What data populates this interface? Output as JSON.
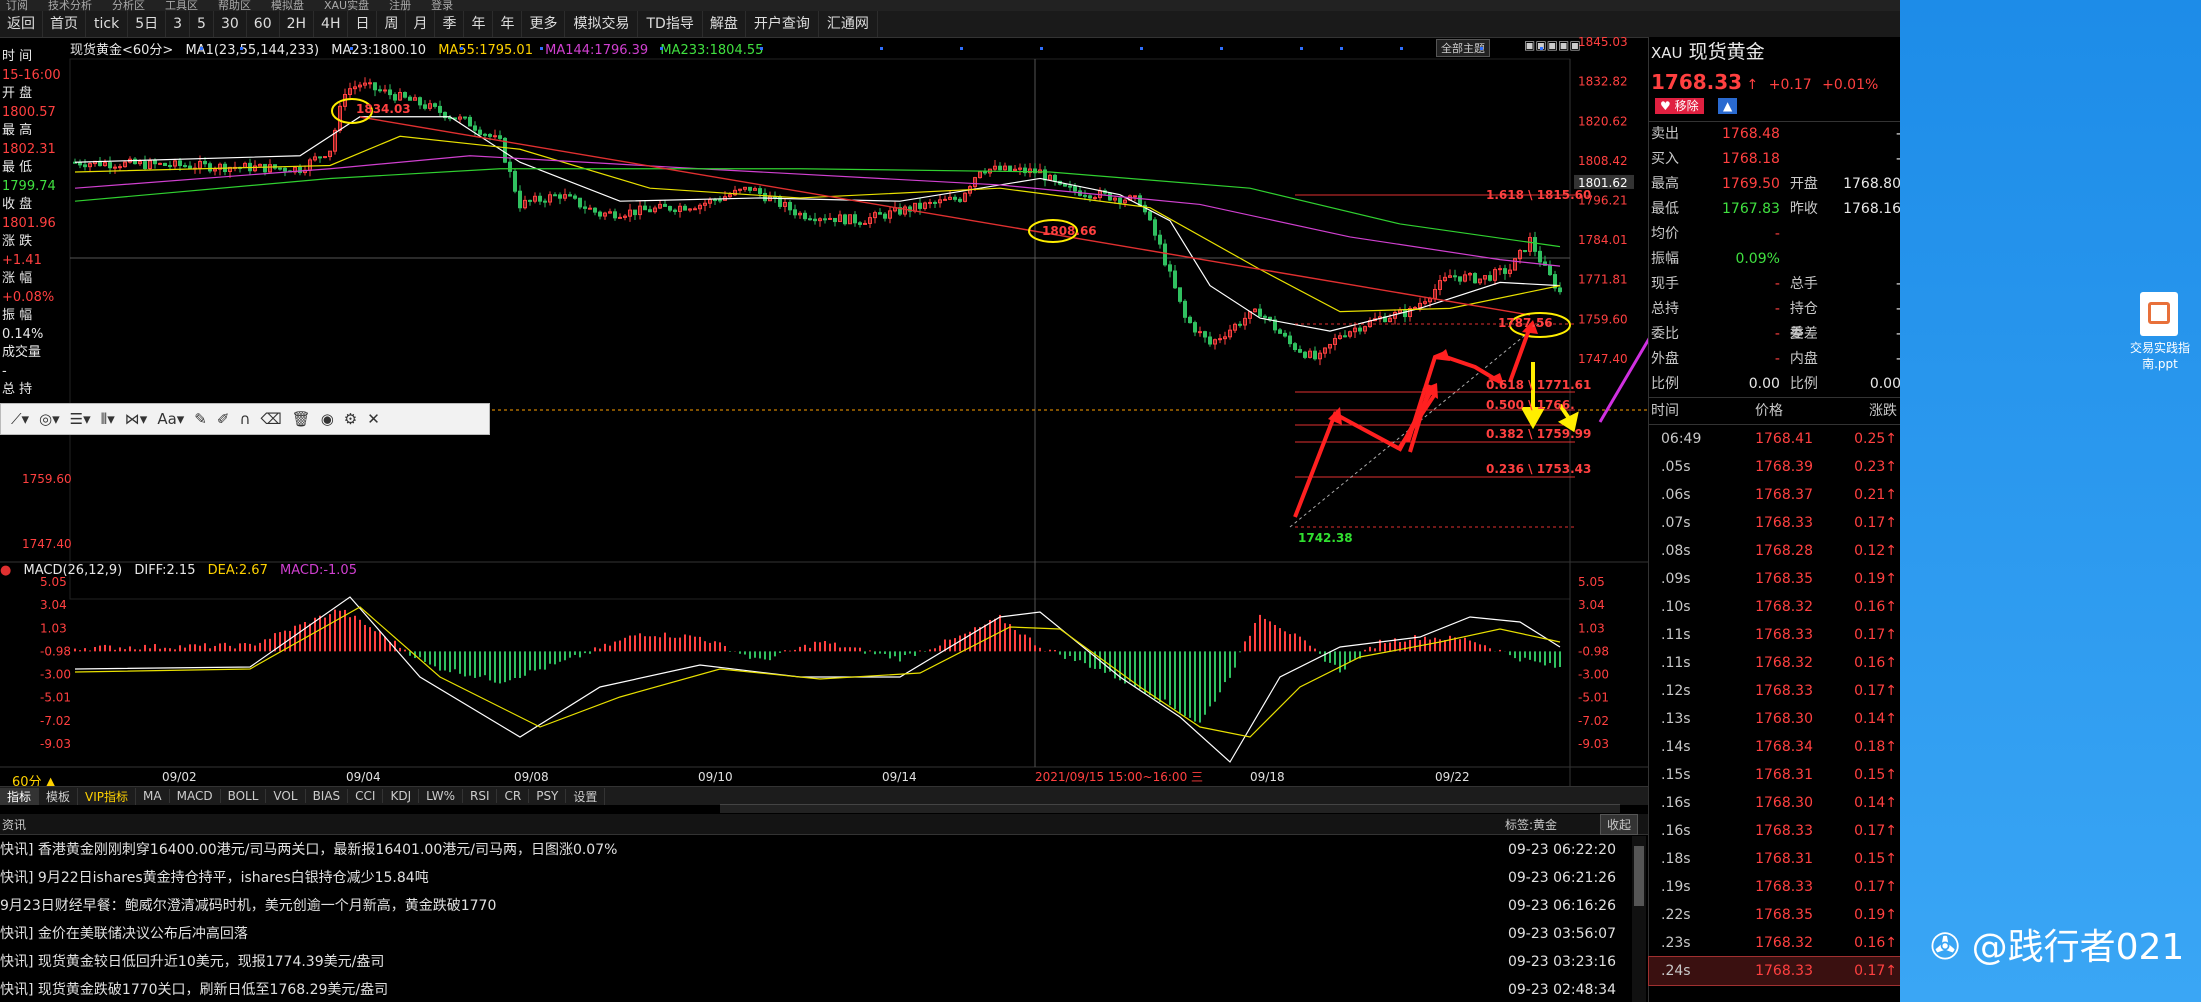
{
  "topstrip": [
    "订阅",
    "技术分析",
    "分析区",
    "工具区",
    "帮助区",
    "模拟盘",
    "XAU实盘",
    "注册",
    "登录"
  ],
  "toolbar": [
    "返回",
    "首页",
    "tick",
    "5日",
    "3",
    "5",
    "30",
    "60",
    "2H",
    "4H",
    "日",
    "周",
    "月",
    "季",
    "年",
    "年",
    "更多",
    "模拟交易",
    "TD指导",
    "解盘",
    "开户查询",
    "汇通网"
  ],
  "legend": {
    "name": "现货黄金<60分>",
    "ma1": "MA1(23,55,144,233)",
    "ma23": "MA23:1800.10",
    "ma55": "MA55:1795.01",
    "ma144": "MA144:1796.39",
    "ma233": "MA233:1804.55",
    "theme_button": "全部主题"
  },
  "left_info": [
    {
      "label": "时 间",
      "value": "15-16:00"
    },
    {
      "label": "开 盘",
      "value": "1800.57"
    },
    {
      "label": "最 高",
      "value": "1802.31"
    },
    {
      "label": "最 低",
      "value": "1799.74"
    },
    {
      "label": "收 盘",
      "value": "1801.96"
    },
    {
      "label": "涨 跌",
      "value": "+1.41"
    },
    {
      "label": "涨 幅",
      "value": "+0.08%"
    },
    {
      "label": "振 幅",
      "value": "0.14%"
    },
    {
      "label": "成交量",
      "value": "-"
    },
    {
      "label": "总 持",
      "value": ""
    }
  ],
  "price_axis": [
    "1845.03",
    "1832.82",
    "1820.62",
    "1808.42",
    "1801.62",
    "1796.21",
    "1784.01",
    "1771.81",
    "1759.60",
    "1747.40"
  ],
  "left_axis_extra": [
    "1759.60",
    "1747.40"
  ],
  "chart_labels": {
    "high1": "1834.03",
    "high2": "1808.66",
    "high3": "1787.56",
    "low": "1742.38",
    "fib1618": "1.618 \\ 1815.60",
    "fib0618": "0.618 \\ 1771.61",
    "fib0500": "0.500 \\ 1766.",
    "fib0382": "0.382 \\ 1759.99",
    "fib0236": "0.236 \\ 1753.43"
  },
  "x_axis": [
    "09/02",
    "09/04",
    "09/08",
    "09/10",
    "09/14",
    "2021/09/15 15:00~16:00 三",
    "09/18",
    "09/22"
  ],
  "period_label": "60分",
  "macd_legend": {
    "name": "MACD(26,12,9)",
    "diff": "DIFF:2.15",
    "dea": "DEA:2.67",
    "macd": "MACD:-1.05"
  },
  "macd_axis": [
    "5.05",
    "3.04",
    "1.03",
    "-0.98",
    "-3.00",
    "-5.01",
    "-7.02",
    "-9.03"
  ],
  "indicator_tabs": [
    "指标",
    "模板",
    "VIP指标",
    "MA",
    "MACD",
    "BOLL",
    "VOL",
    "BIAS",
    "CCI",
    "KDJ",
    "LW%",
    "RSI",
    "CR",
    "PSY",
    "设置"
  ],
  "news_header": {
    "left": "资讯",
    "tag": "标签:黄金",
    "collapse": "收起"
  },
  "news": [
    {
      "text": "快讯] 香港黄金刚刚刺穿16400.00港元/司马两关口，最新报16401.00港元/司马两，日图涨0.07%",
      "time": "09-23 06:22:20"
    },
    {
      "text": "快讯] 9月22日ishares黄金持仓持平，ishares白银持仓减少15.84吨",
      "time": "09-23 06:21:26"
    },
    {
      "text": "9月23日财经早餐：鲍威尔澄清减码时机，美元创逾一个月新高，黄金跌破1770",
      "time": "09-23 06:16:26"
    },
    {
      "text": "快讯] 金价在美联储决议公布后冲高回落",
      "time": "09-23 03:56:07"
    },
    {
      "text": "快讯] 现货黄金较日低回升近10美元，现报1774.39美元/盎司",
      "time": "09-23 03:23:16"
    },
    {
      "text": "快讯] 现货黄金跌破1770关口，刷新日低至1768.29美元/盎司",
      "time": "09-23 02:48:34"
    }
  ],
  "quote": {
    "code": "XAU",
    "name": "现货黄金",
    "price": "1768.33",
    "change": "+0.17",
    "pct": "+0.01%",
    "remove": "移除",
    "rows": [
      {
        "l1": "卖出",
        "v1": "1768.48",
        "l2": "",
        "v2": "-"
      },
      {
        "l1": "买入",
        "v1": "1768.18",
        "l2": "",
        "v2": "-"
      },
      {
        "l1": "最高",
        "v1": "1769.50",
        "l2": "开盘",
        "v2": "1768.80"
      },
      {
        "l1": "最低",
        "v1": "1767.83",
        "l2": "昨收",
        "v2": "1768.16"
      },
      {
        "l1": "均价",
        "v1": "-",
        "l2": "",
        "v2": ""
      },
      {
        "l1": "振幅",
        "v1": "0.09%",
        "l2": "",
        "v2": ""
      },
      {
        "l1": "现手",
        "v1": "-",
        "l2": "总手",
        "v2": "-"
      },
      {
        "l1": "总持",
        "v1": "-",
        "l2": "持仓差",
        "v2": "-"
      },
      {
        "l1": "委比",
        "v1": "-",
        "l2": "委差",
        "v2": "-"
      },
      {
        "l1": "外盘",
        "v1": "-",
        "l2": "内盘",
        "v2": "-"
      },
      {
        "l1": "比例",
        "v1": "0.00",
        "l2": "比例",
        "v2": "0.00"
      }
    ],
    "tick_header": {
      "t": "时间",
      "p": "价格",
      "c": "涨跌"
    },
    "ticks": [
      {
        "t": "06:49",
        "p": "1768.41",
        "c": "0.25"
      },
      {
        "t": ".05s",
        "p": "1768.39",
        "c": "0.23"
      },
      {
        "t": ".06s",
        "p": "1768.37",
        "c": "0.21"
      },
      {
        "t": ".07s",
        "p": "1768.33",
        "c": "0.17"
      },
      {
        "t": ".08s",
        "p": "1768.28",
        "c": "0.12"
      },
      {
        "t": ".09s",
        "p": "1768.35",
        "c": "0.19"
      },
      {
        "t": ".10s",
        "p": "1768.32",
        "c": "0.16"
      },
      {
        "t": ".11s",
        "p": "1768.33",
        "c": "0.17"
      },
      {
        "t": ".11s",
        "p": "1768.32",
        "c": "0.16"
      },
      {
        "t": ".12s",
        "p": "1768.33",
        "c": "0.17"
      },
      {
        "t": ".13s",
        "p": "1768.30",
        "c": "0.14"
      },
      {
        "t": ".14s",
        "p": "1768.34",
        "c": "0.18"
      },
      {
        "t": ".15s",
        "p": "1768.31",
        "c": "0.15"
      },
      {
        "t": ".16s",
        "p": "1768.30",
        "c": "0.14"
      },
      {
        "t": ".16s",
        "p": "1768.33",
        "c": "0.17"
      },
      {
        "t": ".18s",
        "p": "1768.31",
        "c": "0.15"
      },
      {
        "t": ".19s",
        "p": "1768.33",
        "c": "0.17"
      },
      {
        "t": ".22s",
        "p": "1768.35",
        "c": "0.19"
      },
      {
        "t": ".23s",
        "p": "1768.32",
        "c": "0.16"
      },
      {
        "t": ".24s",
        "p": "1768.33",
        "c": "0.17"
      }
    ]
  },
  "desktop": {
    "file_label": "交易实践指南.ppt",
    "watermark": "@践行者021"
  },
  "colors": {
    "up": "#ff4040",
    "down": "#30c060",
    "ma23": "#ffffff",
    "ma55": "#e8e000",
    "ma144": "#d040d0",
    "ma233": "#30d030",
    "accent": "#ffd200"
  }
}
